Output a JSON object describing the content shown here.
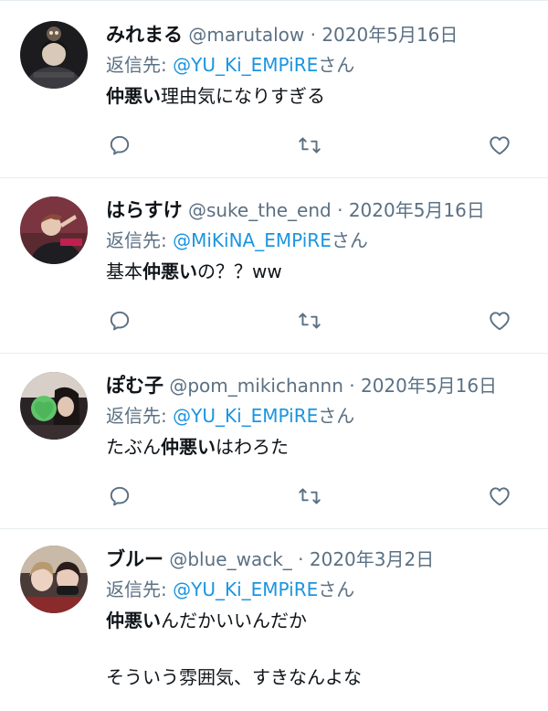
{
  "tweets": [
    {
      "display_name": "みれまる",
      "handle": "@marutalow",
      "separator": " · ",
      "date": "2020年5月16日",
      "reply_prefix": "返信先: ",
      "reply_mention": "@YU_Ki_EMPiRE",
      "reply_suffix": "さん",
      "lines": [
        {
          "bold": "仲悪い",
          "after": "理由気になりすぎる"
        }
      ]
    },
    {
      "display_name": "はらすけ",
      "handle": "@suke_the_end",
      "separator": " · ",
      "date": "2020年5月16日",
      "reply_prefix": "返信先: ",
      "reply_mention": "@MiKiNA_EMPiRE",
      "reply_suffix": "さん",
      "lines": [
        {
          "before": "基本",
          "bold": "仲悪い",
          "after": "の？？ww"
        }
      ]
    },
    {
      "display_name": "ぽむ子",
      "handle": "@pom_mikichannn",
      "separator": " · ",
      "date": "2020年5月16日",
      "reply_prefix": "返信先: ",
      "reply_mention": "@YU_Ki_EMPiRE",
      "reply_suffix": "さん",
      "lines": [
        {
          "before": "たぶん",
          "bold": "仲悪い",
          "after": "はわろた"
        }
      ]
    },
    {
      "display_name": "ブルー",
      "handle": "@blue_wack_",
      "separator": " · ",
      "date": "2020年3月2日",
      "reply_prefix": "返信先: ",
      "reply_mention": "@YU_Ki_EMPiRE",
      "reply_suffix": "さん",
      "lines": [
        {
          "bold": "仲悪い",
          "after": "んだかいいんだか"
        },
        {
          "after": "そういう雰囲気、すきなんよな"
        }
      ]
    }
  ],
  "icons": {
    "reply": "reply-icon",
    "retweet": "retweet-icon",
    "like": "heart-icon"
  },
  "colors": {
    "name": "#0f1419",
    "meta": "#5b7083",
    "mention": "#1b95e0",
    "divider": "#e6ecf0",
    "icon": "#5b7083"
  }
}
